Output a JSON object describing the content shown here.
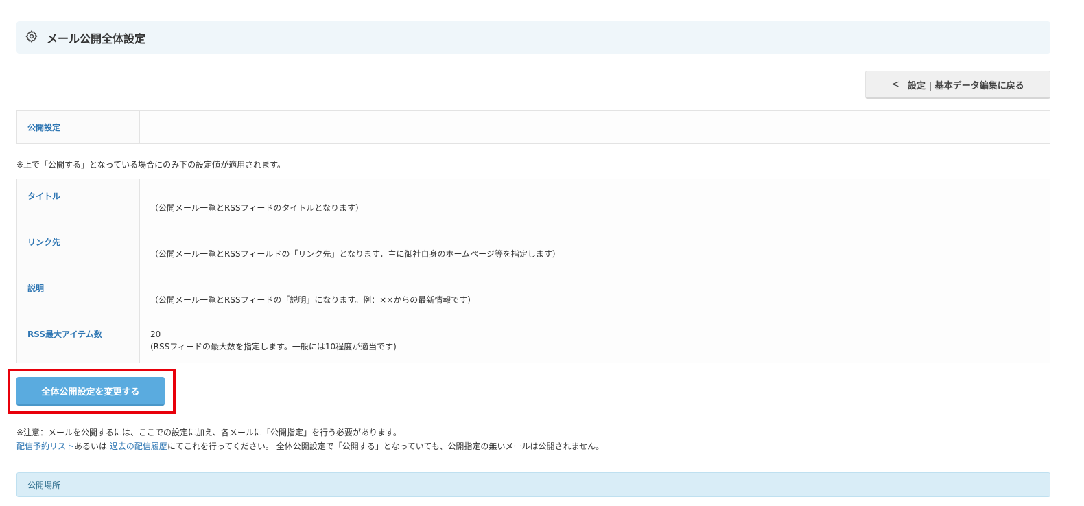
{
  "header": {
    "icon": "gear-icon",
    "title": "メール公開全体設定"
  },
  "back_button": {
    "icon": "chevron-left-icon",
    "chevron": "<",
    "label": "設定 | 基本データ編集に戻る"
  },
  "publish_table": {
    "label": "公開設定",
    "value": ""
  },
  "note_top": "※上で「公開する」となっている場合にのみ下の設定値が適用されます。",
  "settings": {
    "rows": [
      {
        "label": "タイトル",
        "value": "",
        "hint": "（公開メール一覧とRSSフィードのタイトルとなります）"
      },
      {
        "label": "リンク先",
        "value": "",
        "hint": "（公開メール一覧とRSSフィールドの「リンク先」となります．主に御社自身のホームページ等を指定します）"
      },
      {
        "label": "説明",
        "value": "",
        "hint": "（公開メール一覧とRSSフィードの「説明」になります。例：××からの最新情報です）"
      },
      {
        "label": "RSS最大アイテム数",
        "value": "20",
        "hint": "(RSSフィードの最大数を指定します。一般には10程度が適当です)"
      }
    ]
  },
  "submit_button": {
    "label": "全体公開設定を変更する"
  },
  "note_bottom": {
    "line1": "※注意：メールを公開するには、ここでの設定に加え、各メールに「公開指定」を行う必要があります。",
    "link1": "配信予約リスト",
    "mid": "あるいは ",
    "link2": "過去の配信履歴",
    "tail": "にてこれを行ってください。 全体公開設定で「公開する」となっていても、公開指定の無いメールは公開されません。"
  },
  "section": {
    "title": "公開場所"
  },
  "colors": {
    "accent": "#5aabdf",
    "label_text": "#2e76b3",
    "highlight": "#e8000b",
    "section_bg": "#d9edf7"
  }
}
